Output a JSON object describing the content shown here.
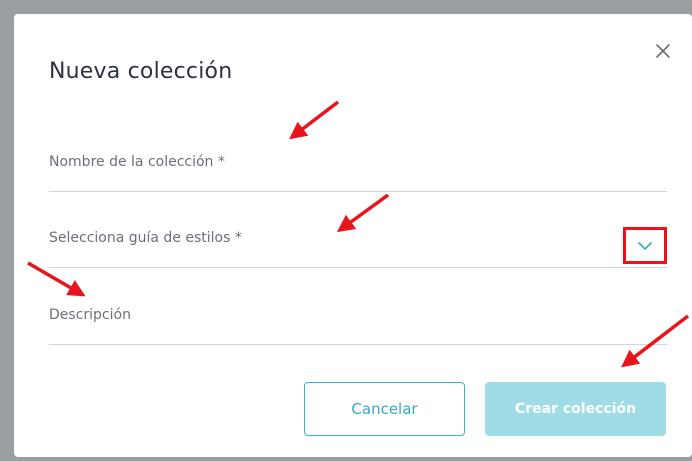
{
  "dialog": {
    "title": "Nueva colección",
    "close_icon": "close-icon"
  },
  "form": {
    "name_label": "Nombre de la colección *",
    "style_guide_label": "Selecciona guía de estilos *",
    "style_guide_icon": "chevron-down-icon",
    "description_label": "Descripción"
  },
  "actions": {
    "cancel_label": "Cancelar",
    "create_label": "Crear colección"
  },
  "colors": {
    "accent": "#39b3c6",
    "accent_disabled": "#9fdce6",
    "annotation": "#e8141b",
    "overlay": "#9b9ea3"
  }
}
